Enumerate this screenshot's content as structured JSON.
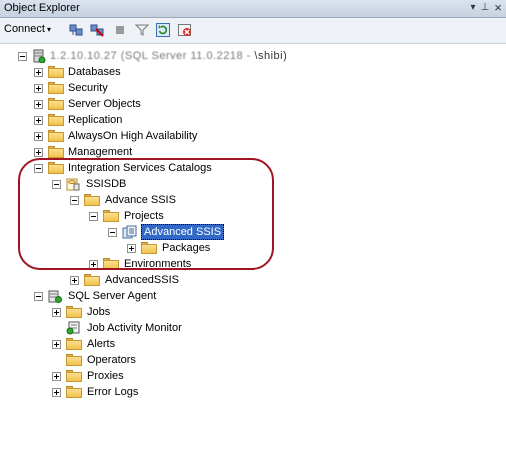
{
  "window": {
    "title": "Object Explorer",
    "pin_glyph": "▾",
    "autohide_glyph": "⊥",
    "close_glyph": "×"
  },
  "toolbar": {
    "connect_label": "Connect",
    "connect_caret": "▾"
  },
  "tree": {
    "server": {
      "label_prefix": "1.2.10.10.27 (SQL Server 11.0.2218 - ",
      "label_obscured": "\\shibi)"
    },
    "items": {
      "databases": "Databases",
      "security": "Security",
      "server_objects": "Server Objects",
      "replication": "Replication",
      "alwayson": "AlwaysOn High Availability",
      "management": "Management",
      "isc": "Integration Services Catalogs",
      "ssisdb": "SSISDB",
      "advance_ssis": "Advance SSIS",
      "projects": "Projects",
      "advanced_ssis": "Advanced SSIS",
      "packages": "Packages",
      "environments": "Environments",
      "advancedssis": "AdvancedSSIS",
      "sql_agent": "SQL Server Agent",
      "jobs": "Jobs",
      "job_activity_monitor": "Job Activity Monitor",
      "alerts": "Alerts",
      "operators": "Operators",
      "proxies": "Proxies",
      "error_logs": "Error Logs"
    }
  },
  "colors": {
    "selection": "#3169c6",
    "highlight_oval": "#a01522",
    "folder": "#f1c24d"
  }
}
